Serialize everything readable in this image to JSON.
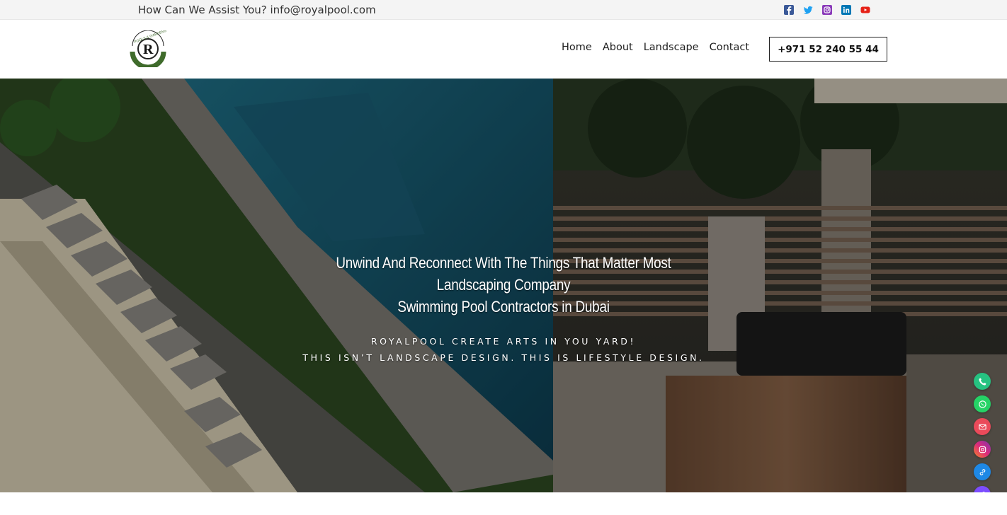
{
  "topbar": {
    "assist_text": "How Can We Assist You? info@royalpool.com",
    "social_icons": [
      {
        "name": "facebook-icon",
        "color": "#3b5998"
      },
      {
        "name": "twitter-icon",
        "color": "#1da1f2"
      },
      {
        "name": "instagram-icon",
        "color": "#8a3ab9"
      },
      {
        "name": "linkedin-icon",
        "color": "#0077b5"
      },
      {
        "name": "youtube-icon",
        "color": "#e62117"
      }
    ]
  },
  "header": {
    "logo_letter": "R",
    "logo_ring_text": "POOLS & GARDENS",
    "nav": [
      "Home",
      "About",
      "Landscape",
      "Contact"
    ],
    "phone": "+971 52 240 55 44"
  },
  "hero": {
    "headline_lines": [
      "Unwind And Reconnect With The Things That Matter Most",
      "Landscaping Company",
      "Swimming Pool Contractors in Dubai"
    ],
    "sub_lines": [
      "ROYALPOOL CREATE ARTS IN YOU YARD!",
      "THIS ISN’T LANDSCAPE DESIGN. THIS IS LIFESTYLE DESIGN."
    ]
  },
  "floating_buttons": [
    {
      "name": "phone-icon",
      "color": "#26c281"
    },
    {
      "name": "whatsapp-icon",
      "color": "#25d366"
    },
    {
      "name": "email-icon",
      "color": "#ea4a5a"
    },
    {
      "name": "instagram-icon",
      "color": "#c13584"
    },
    {
      "name": "link-icon",
      "color": "#1e88e5"
    },
    {
      "name": "link-icon",
      "color": "#7c4dff"
    }
  ]
}
